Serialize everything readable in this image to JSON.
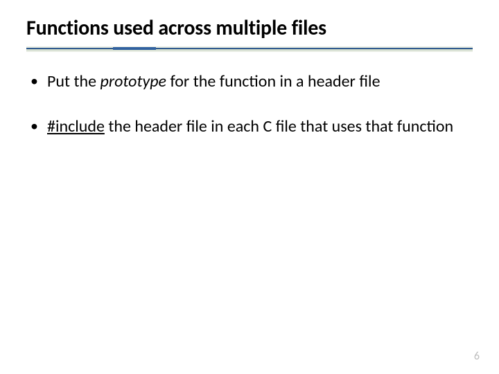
{
  "title": "Functions used across multiple files",
  "bullets": [
    {
      "pre": "Put the ",
      "em": "prototype",
      "post": " for the function in a header file",
      "emClass": "italic"
    },
    {
      "pre": "",
      "em": "#include",
      "post": " the header file in each C file that uses that function",
      "emClass": "uline"
    }
  ],
  "pageNumber": "6"
}
